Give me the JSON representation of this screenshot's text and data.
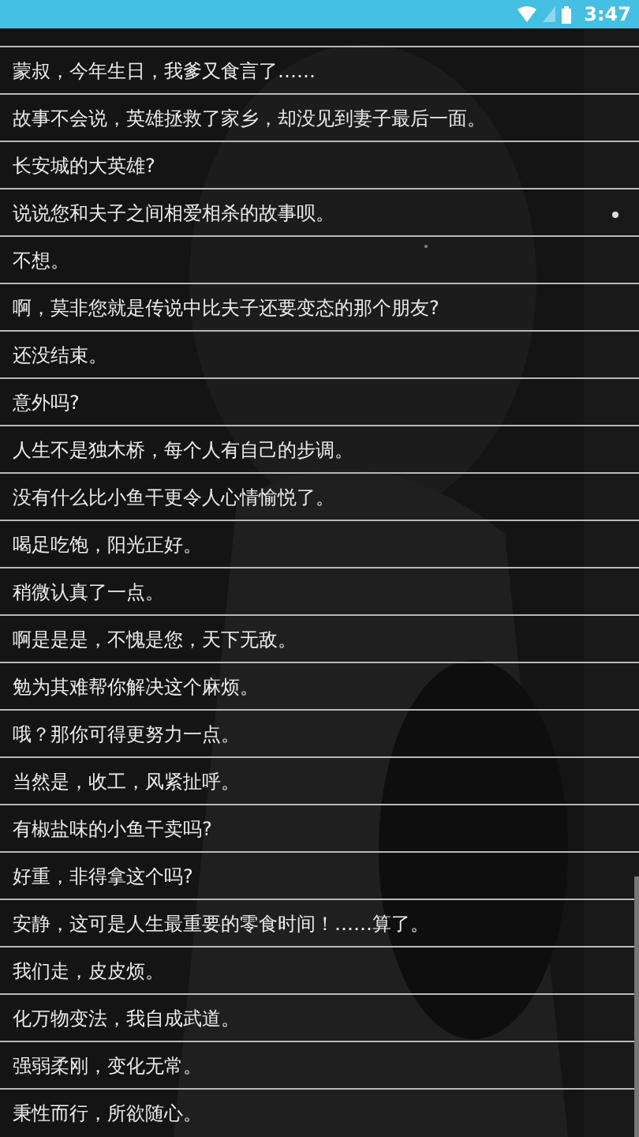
{
  "status_bar": {
    "time": "3:47"
  },
  "lines": [
    {
      "text": "蒙叔，今年生日，我爹又食言了……"
    },
    {
      "text": "故事不会说，英雄拯救了家乡，却没见到妻子最后一面。"
    },
    {
      "text": "长安城的大英雄?"
    },
    {
      "text": "说说您和夫子之间相爱相杀的故事呗。"
    },
    {
      "text": "不想。"
    },
    {
      "text": "啊，莫非您就是传说中比夫子还要变态的那个朋友?"
    },
    {
      "text": "还没结束。"
    },
    {
      "text": "意外吗?"
    },
    {
      "text": "人生不是独木桥，每个人有自己的步调。"
    },
    {
      "text": "没有什么比小鱼干更令人心情愉悦了。"
    },
    {
      "text": "喝足吃饱，阳光正好。"
    },
    {
      "text": "稍微认真了一点。"
    },
    {
      "text": "啊是是是，不愧是您，天下无敌。"
    },
    {
      "text": "勉为其难帮你解决这个麻烦。"
    },
    {
      "text": "哦？那你可得更努力一点。"
    },
    {
      "text": "当然是，收工，风紧扯呼。"
    },
    {
      "text": "有椒盐味的小鱼干卖吗?"
    },
    {
      "text": "好重，非得拿这个吗?"
    },
    {
      "text": "安静，这可是人生最重要的零食时间！……算了。"
    },
    {
      "text": "我们走，皮皮烦。"
    },
    {
      "text": "化万物变法，我自成武道。"
    },
    {
      "text": "强弱柔刚，变化无常。"
    },
    {
      "text": "秉性而行，所欲随心。"
    }
  ]
}
